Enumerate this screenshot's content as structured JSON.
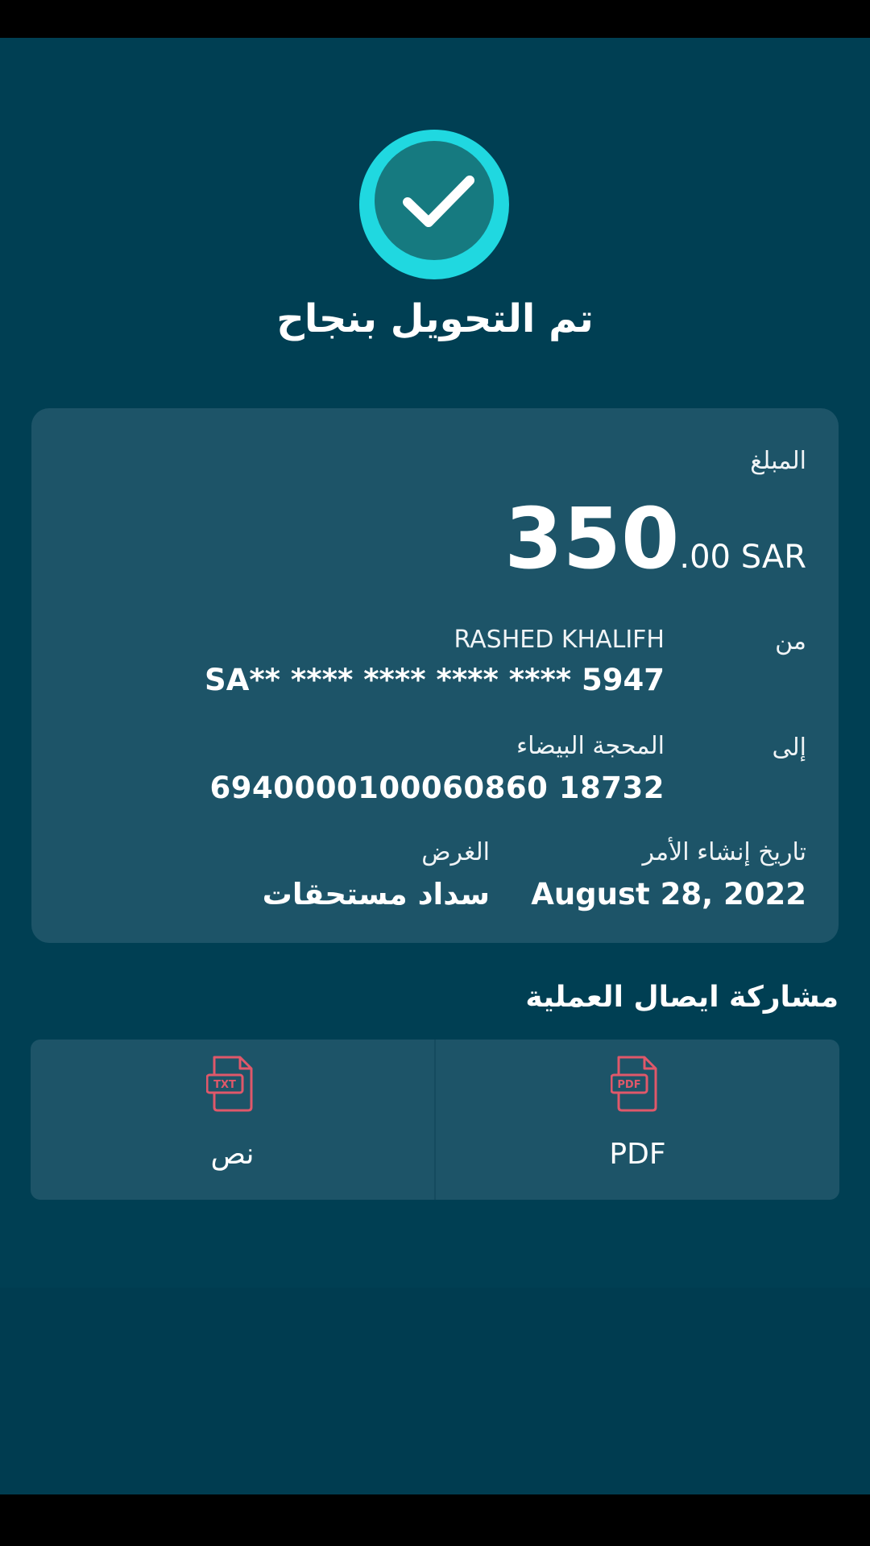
{
  "header": {
    "title": "تم التحويل بنجاح",
    "icon": "check-circle-icon",
    "badge_color": "#20d8e0"
  },
  "details": {
    "amount_label": "المبلغ",
    "amount_whole": "350",
    "amount_fraction": ".00 SAR",
    "from_label": "من",
    "from_name": "RASHED KHALIFH",
    "from_account": "SA** **** **** **** **** 5947",
    "to_label": "إلى",
    "to_name": "المحجة البيضاء",
    "to_account": "6940000100060860 18732",
    "date_label": "تاريخ إنشاء الأمر",
    "date_value": "August 28, 2022",
    "purpose_label": "الغرض",
    "purpose_value": "سداد مستحقات"
  },
  "share": {
    "heading": "مشاركة ايصال العملية",
    "options": [
      {
        "label": "PDF",
        "icon": "pdf-file-icon"
      },
      {
        "label": "نص",
        "icon": "txt-file-icon"
      }
    ],
    "icon_color": "#e0586a"
  },
  "colors": {
    "background": "#003f53",
    "card": "#1d5468"
  }
}
